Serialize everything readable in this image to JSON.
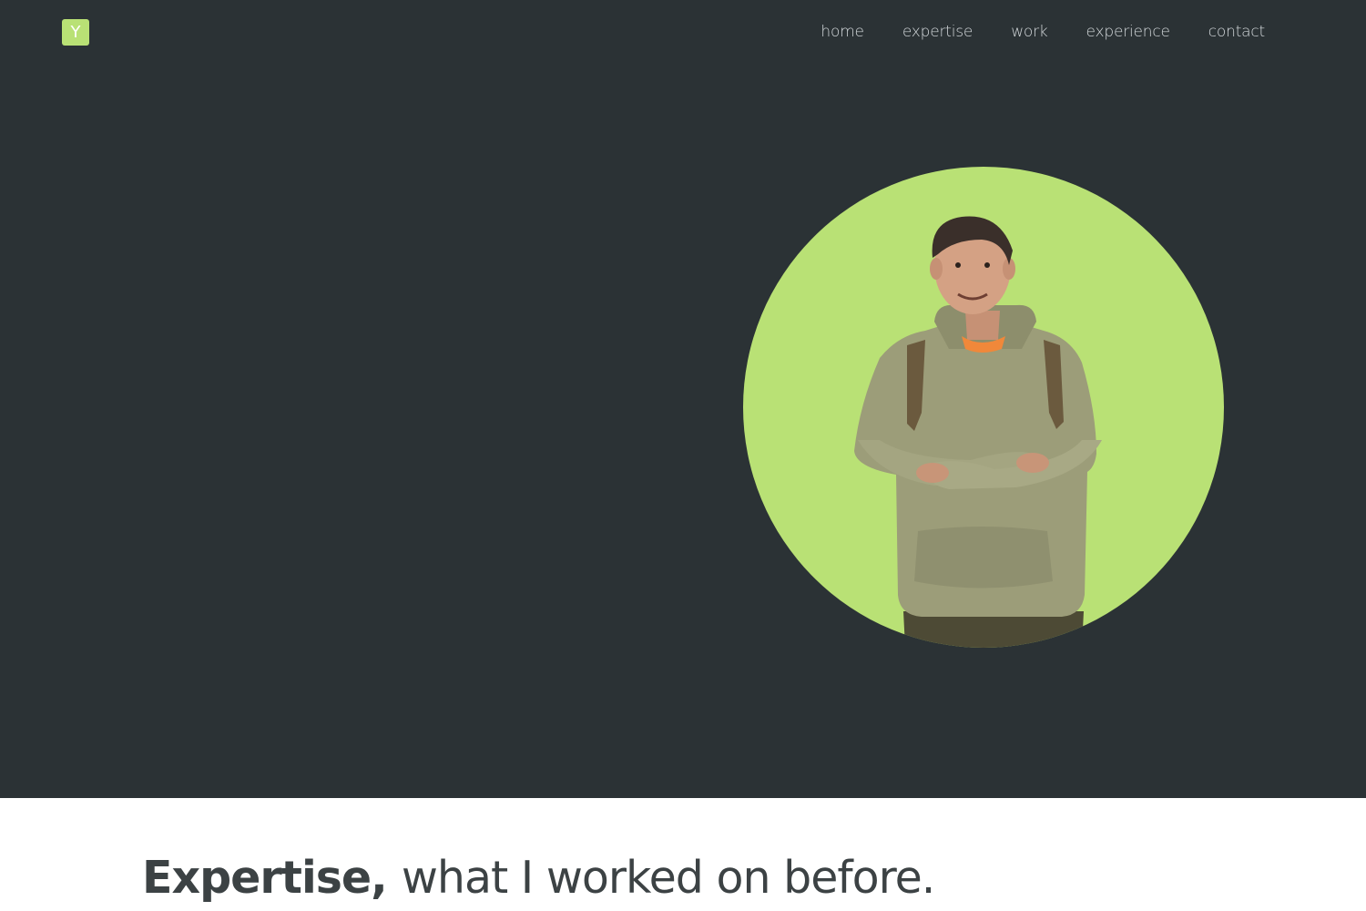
{
  "header": {
    "logo_letter": "Y",
    "nav": [
      {
        "label": "home"
      },
      {
        "label": "expertise"
      },
      {
        "label": "work"
      },
      {
        "label": "experience"
      },
      {
        "label": "contact"
      }
    ]
  },
  "hero": {
    "portrait_icon": "person-photo"
  },
  "expertise": {
    "heading_strong": "Expertise,",
    "heading_rest": "what I worked on before."
  },
  "colors": {
    "hero_background": "#2b3235",
    "accent": "#b9e175",
    "nav_text": "#d4d9dc",
    "heading_text": "#3c4244",
    "page_background": "#ffffff"
  }
}
